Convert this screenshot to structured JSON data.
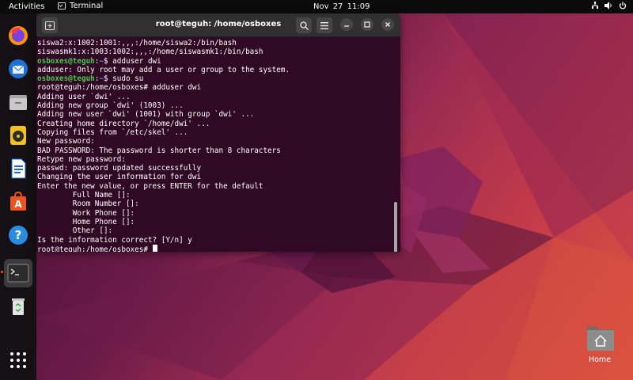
{
  "topbar": {
    "activities": "Activities",
    "app_name": "Terminal",
    "clock_date": "Nov 27",
    "clock_time": "11:09",
    "icons": [
      "network-icon",
      "volume-icon",
      "power-icon"
    ]
  },
  "dock": {
    "items": [
      {
        "name": "firefox",
        "icon": "firefox-icon"
      },
      {
        "name": "thunderbird",
        "icon": "thunderbird-icon"
      },
      {
        "name": "files",
        "icon": "files-icon"
      },
      {
        "name": "rhythmbox",
        "icon": "rhythmbox-icon"
      },
      {
        "name": "libreoffice-writer",
        "icon": "writer-icon"
      },
      {
        "name": "ubuntu-software",
        "icon": "software-icon"
      },
      {
        "name": "help",
        "icon": "help-icon"
      },
      {
        "name": "terminal",
        "icon": "terminal-icon",
        "active": true
      },
      {
        "name": "trash",
        "icon": "trash-icon"
      },
      {
        "name": "show-apps",
        "icon": "apps-grid-icon"
      }
    ]
  },
  "terminal": {
    "title": "root@teguh: /home/osboxes",
    "lines": [
      {
        "text": "siswa2:x:1002:1001:,,,:/home/siswa2:/bin/bash"
      },
      {
        "text": "siswasmk1:x:1003:1002:,,,:/home/siswasmk1:/bin/bash"
      },
      {
        "user": "osboxes@teguh",
        "path": "~",
        "cmd": "$ adduser dwi"
      },
      {
        "text": "adduser: Only root may add a user or group to the system."
      },
      {
        "user": "osboxes@teguh",
        "path": "~",
        "cmd": "$ sudo su"
      },
      {
        "text": "root@teguh:/home/osboxes# adduser dwi"
      },
      {
        "text": "Adding user `dwi' ..."
      },
      {
        "text": "Adding new group `dwi' (1003) ..."
      },
      {
        "text": "Adding new user `dwi' (1001) with group `dwi' ..."
      },
      {
        "text": "Creating home directory `/home/dwi' ..."
      },
      {
        "text": "Copying files from `/etc/skel' ..."
      },
      {
        "text": "New password:"
      },
      {
        "text": "BAD PASSWORD: The password is shorter than 8 characters"
      },
      {
        "text": "Retype new password:"
      },
      {
        "text": "passwd: password updated successfully"
      },
      {
        "text": "Changing the user information for dwi"
      },
      {
        "text": "Enter the new value, or press ENTER for the default"
      },
      {
        "text": "\tFull Name []:"
      },
      {
        "text": "\tRoom Number []:"
      },
      {
        "text": "\tWork Phone []:"
      },
      {
        "text": "\tHome Phone []:"
      },
      {
        "text": "\tOther []:"
      },
      {
        "text": "Is the information correct? [Y/n] y"
      }
    ],
    "current_prompt": "root@teguh:/home/osboxes# "
  },
  "desktop": {
    "home_label": "Home"
  }
}
